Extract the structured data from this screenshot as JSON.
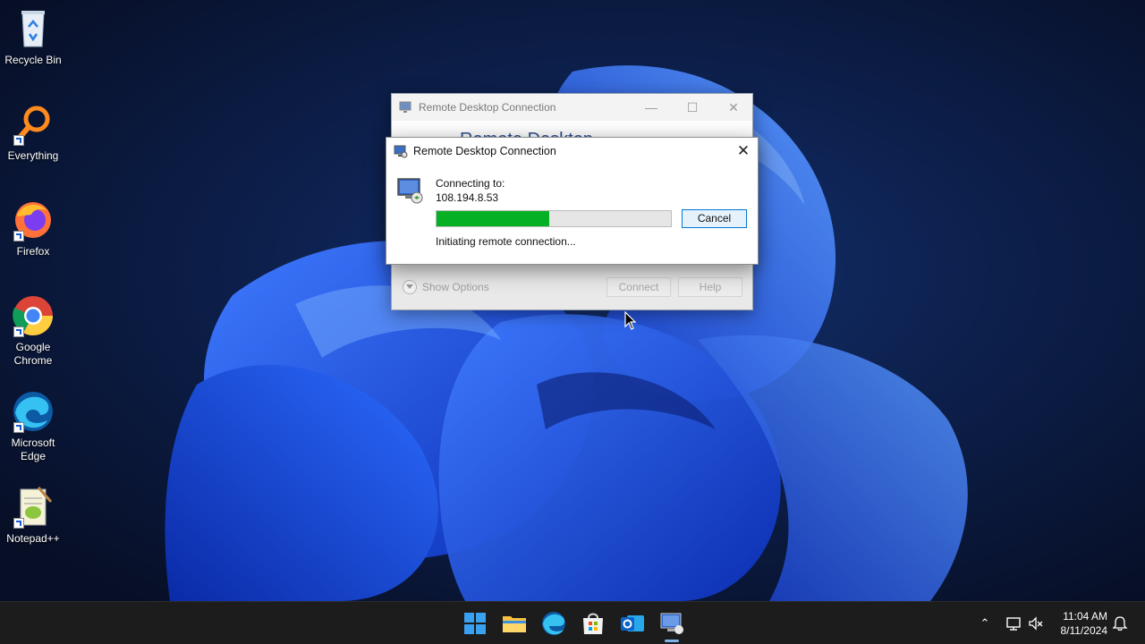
{
  "desktop": {
    "icons": [
      {
        "label": "Recycle Bin"
      },
      {
        "label": "Everything"
      },
      {
        "label": "Firefox"
      },
      {
        "label": "Google Chrome"
      },
      {
        "label": "Microsoft Edge"
      },
      {
        "label": "Notepad++"
      }
    ]
  },
  "background_window": {
    "title": "Remote Desktop Connection",
    "banner_text": "Remote Desktop",
    "show_options_label": "Show Options",
    "connect_label": "Connect",
    "help_label": "Help"
  },
  "dialog": {
    "title": "Remote Desktop Connection",
    "connecting_label": "Connecting to:",
    "host": "108.194.8.53",
    "progress_fraction": 0.48,
    "cancel_label": "Cancel",
    "status": "Initiating remote connection..."
  },
  "taskbar": {
    "apps": [
      "start-icon",
      "file-explorer-icon",
      "edge-icon",
      "store-icon",
      "outlook-icon",
      "remote-desktop-icon"
    ],
    "clock_time": "11:04 AM",
    "clock_date": "8/11/2024"
  },
  "colors": {
    "progress_fill": "#06b025",
    "accent": "#0078d7",
    "taskbar": "#1c1c1c"
  }
}
